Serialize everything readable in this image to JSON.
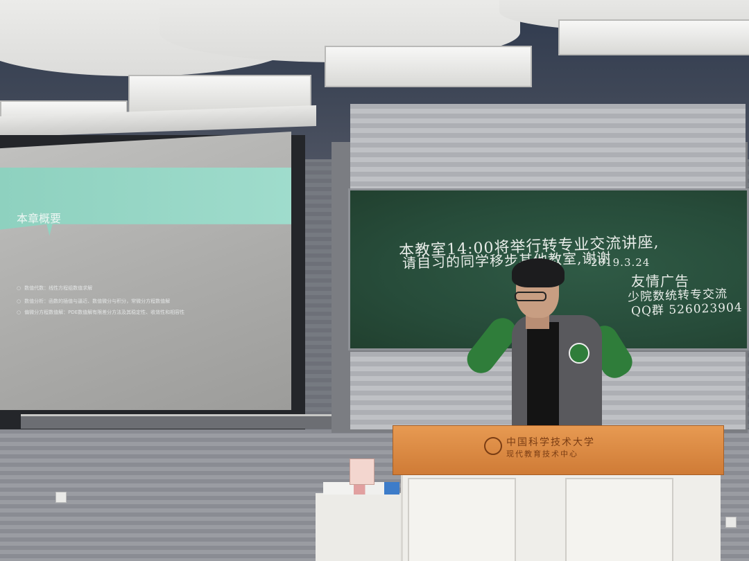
{
  "slide": {
    "title": "本章概要",
    "bullets": [
      "数值代数：线性方程组数值求解",
      "数值分析：函数的插值与逼近、数值微分与积分，常微分方程数值解",
      "偏微分方程数值解：PDE数值解有限差分方法及其稳定性、收敛性和相容性"
    ]
  },
  "chalkboard": {
    "line1": "本教室14:00将举行转专业交流讲座,",
    "line2": "请自习的同学移步其他教室,谢谢",
    "date": "2019.3.24",
    "ad_title": "友情广告",
    "ad_line": "少院数统转专交流",
    "qq_group": "QQ群 526023904"
  },
  "lectern": {
    "university": "中国科学技术大学",
    "center": "现代教育技术中心"
  }
}
